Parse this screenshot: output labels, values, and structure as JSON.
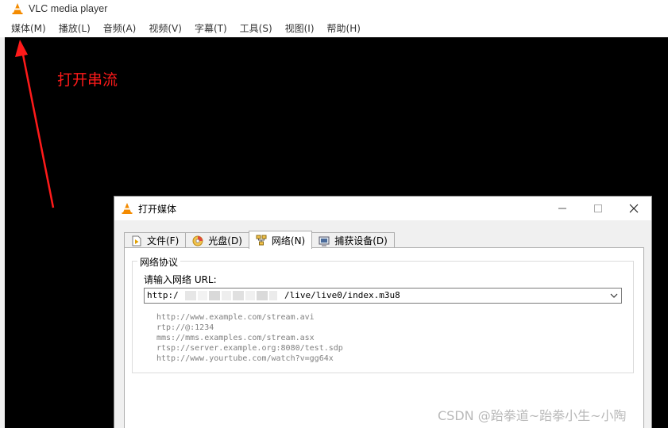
{
  "app": {
    "title": "VLC media player"
  },
  "menubar": {
    "items": [
      "媒体(M)",
      "播放(L)",
      "音频(A)",
      "视频(V)",
      "字幕(T)",
      "工具(S)",
      "视图(I)",
      "帮助(H)"
    ]
  },
  "annotation": {
    "text": "打开串流",
    "color": "#ff1a1a"
  },
  "dialog": {
    "title": "打开媒体",
    "window_buttons": {
      "minimize": "—",
      "maximize": "☐",
      "close": "✕"
    },
    "tabs": [
      {
        "label": "文件(F)",
        "icon": "file-play-icon",
        "active": false
      },
      {
        "label": "光盘(D)",
        "icon": "disc-icon",
        "active": false
      },
      {
        "label": "网络(N)",
        "icon": "network-icon",
        "active": true
      },
      {
        "label": "捕获设备(D)",
        "icon": "capture-device-icon",
        "active": false
      }
    ],
    "network": {
      "group_title": "网络协议",
      "url_label": "请输入网络 URL:",
      "url_prefix": "http:/",
      "url_suffix": "/live/live0/index.m3u8",
      "examples": [
        "http://www.example.com/stream.avi",
        "rtp://@:1234",
        "mms://mms.examples.com/stream.asx",
        "rtsp://server.example.org:8080/test.sdp",
        "http://www.yourtube.com/watch?v=gg64x"
      ]
    }
  },
  "watermark": {
    "text": "CSDN @跆拳道~跆拳小生~小陶"
  },
  "colors": {
    "vlc_orange": "#f48b00",
    "video_bg": "#000000",
    "dialog_bg": "#f0f0f0"
  }
}
